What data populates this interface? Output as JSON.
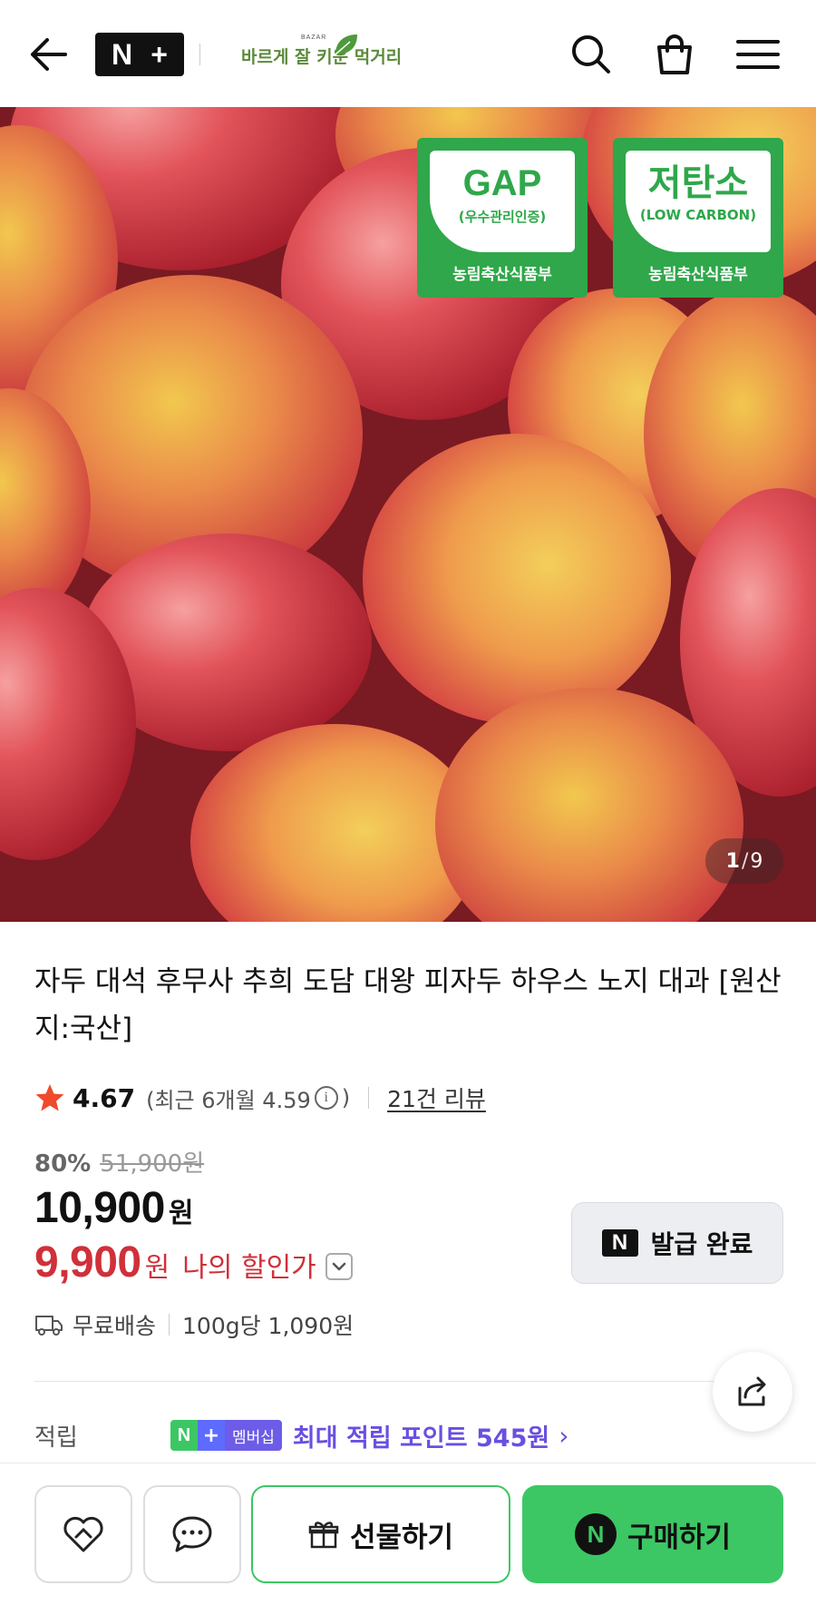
{
  "header": {
    "back_icon": "arrow-left-icon",
    "brand_badge": {
      "n": "N",
      "plus": "+"
    },
    "store_logo_text": "바르게 잘 키운 먹거리",
    "store_logo_sub": "BAZAR",
    "icons": [
      "search-icon",
      "shopping-bag-icon",
      "hamburger-menu-icon"
    ]
  },
  "gallery": {
    "badges": [
      {
        "title": "GAP",
        "subtitle": "(우수관리인증)",
        "issuer": "농림축산식품부"
      },
      {
        "title": "저탄소",
        "subtitle": "(LOW CARBON)",
        "issuer": "농림축산식품부"
      }
    ],
    "current": "1",
    "separator": "/",
    "total": "9"
  },
  "product": {
    "title": "자두 대석 후무사 추희 도담 대왕 피자두 하우스 노지 대과 [원산지:국산]",
    "rating": "4.67",
    "recent_rating_prefix": "(최근 6개월 4.59",
    "recent_rating_suffix": ")",
    "info_icon": "i",
    "review_count": "21건 리뷰",
    "discount_pct": "80%",
    "original_price": "51,900원",
    "price": "10,900",
    "price_unit": "원",
    "my_price": "9,900",
    "my_price_unit": "원",
    "my_price_label": "나의 할인가",
    "coupon_button": {
      "icon": "N",
      "label": "발급 완료"
    },
    "shipping": "무료배송",
    "unit_price": "100g당 1,090원",
    "points": {
      "label": "적립",
      "badge_n": "N",
      "badge_plus": "+",
      "badge_text": "멤버십",
      "text": "최대 적립 포인트 545원",
      "chevron": "›"
    }
  },
  "bottom_bar": {
    "gift_label": "선물하기",
    "buy_icon": "N",
    "buy_label": "구매하기"
  },
  "colors": {
    "brand_green": "#3cc764",
    "cert_green": "#2fa74a",
    "price_red": "#d0303a",
    "points_purple": "#6a4fe0"
  }
}
